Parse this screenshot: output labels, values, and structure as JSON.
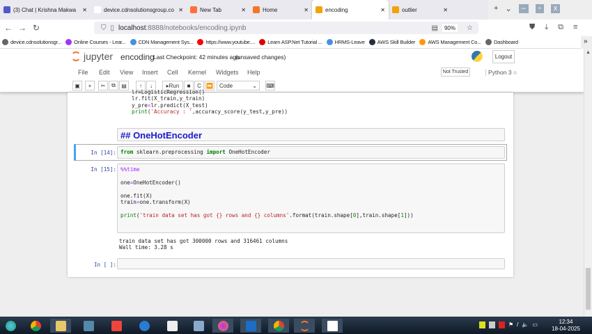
{
  "browser": {
    "tabs": [
      {
        "label": "(3) Chat | Krishna Makwa",
        "color": "#5059c9"
      },
      {
        "label": "device.cdnsolutionsgroup.co",
        "color": "#ffffff"
      },
      {
        "label": "New Tab",
        "color": "#ff7139"
      },
      {
        "label": "Home",
        "color": "#f37726"
      },
      {
        "label": "encoding",
        "color": "#f0a30a",
        "active": true
      },
      {
        "label": "outlier",
        "color": "#f0a30a"
      }
    ],
    "url_host": "localhost",
    "url_path": ":8888/notebooks/encoding.ipynb",
    "zoom": "90%",
    "bookmarks": [
      {
        "label": "device.cdnsolutionsgr...",
        "color": "#666"
      },
      {
        "label": "Online Courses - Lear...",
        "color": "#a435f0"
      },
      {
        "label": "CDN Management Sys...",
        "color": "#4a90d9"
      },
      {
        "label": "https://www.youtube....",
        "color": "#ff0000"
      },
      {
        "label": "Learn ASP.Net Tutorial ...",
        "color": "#d00"
      },
      {
        "label": "HRMS-Leave",
        "color": "#4a90d9"
      },
      {
        "label": "AWS Skill Builder",
        "color": "#232f3e"
      },
      {
        "label": "AWS Management Co...",
        "color": "#ff9900"
      },
      {
        "label": "Dashboard",
        "color": "#666"
      }
    ]
  },
  "jupyter": {
    "logo": "jupyter",
    "name": "encoding",
    "checkpoint": "Last Checkpoint: 42 minutes ago",
    "unsaved": "(unsaved changes)",
    "logout": "Logout",
    "menu": [
      "File",
      "Edit",
      "View",
      "Insert",
      "Cell",
      "Kernel",
      "Widgets",
      "Help"
    ],
    "trusted": "Not Trusted",
    "kernel": "Python 3",
    "run_label": "Run",
    "cell_type": "Code"
  },
  "cells": {
    "prev_code": [
      [
        [
          "lr=LogisticRegression()",
          ""
        ]
      ],
      [
        [
          "lr.fit(X_train,y_train)",
          ""
        ]
      ],
      [
        [
          "y_pre",
          ""
        ],
        [
          "=",
          "op"
        ],
        [
          "lr.predict(X_test)",
          ""
        ]
      ],
      [
        [
          "print",
          "kw2"
        ],
        [
          "(",
          ""
        ],
        [
          "'Accuracy : '",
          "str"
        ],
        [
          ",accuracy_score(y_test,y_pre))",
          ""
        ]
      ]
    ],
    "markdown": "## OneHotEncoder",
    "c14": {
      "prompt": "In [14]:",
      "code": [
        [
          [
            "from",
            "kw"
          ],
          [
            " sklearn.preprocessing ",
            ""
          ],
          [
            "import",
            "kw"
          ],
          [
            " OneHotEncoder",
            ""
          ]
        ]
      ]
    },
    "c15": {
      "prompt": "In [15]:",
      "code": [
        [
          [
            "%%time",
            "mag"
          ]
        ],
        [
          [
            "",
            ""
          ]
        ],
        [
          [
            "one",
            ""
          ],
          [
            "=",
            "op"
          ],
          [
            "OneHotEncoder()",
            ""
          ]
        ],
        [
          [
            "",
            ""
          ]
        ],
        [
          [
            "one.fit(X)",
            ""
          ]
        ],
        [
          [
            "train",
            ""
          ],
          [
            "=",
            "op"
          ],
          [
            "one.transform(X)",
            ""
          ]
        ],
        [
          [
            "",
            ""
          ]
        ],
        [
          [
            "print",
            "kw2"
          ],
          [
            "(",
            ""
          ],
          [
            "'train data set has got {} rows and {} columns'",
            "str"
          ],
          [
            ".format(train.shape[",
            ""
          ],
          [
            "0",
            "num"
          ],
          [
            "],train.shape[",
            ""
          ],
          [
            "1",
            "num"
          ],
          [
            "]))",
            ""
          ]
        ]
      ],
      "output": "train data set has got 300000 rows and 316461 columns\nWall time: 3.28 s"
    },
    "empty": {
      "prompt": "In [ ]:"
    }
  },
  "taskbar": {
    "time": "12:34",
    "date": "18-04-2025"
  }
}
